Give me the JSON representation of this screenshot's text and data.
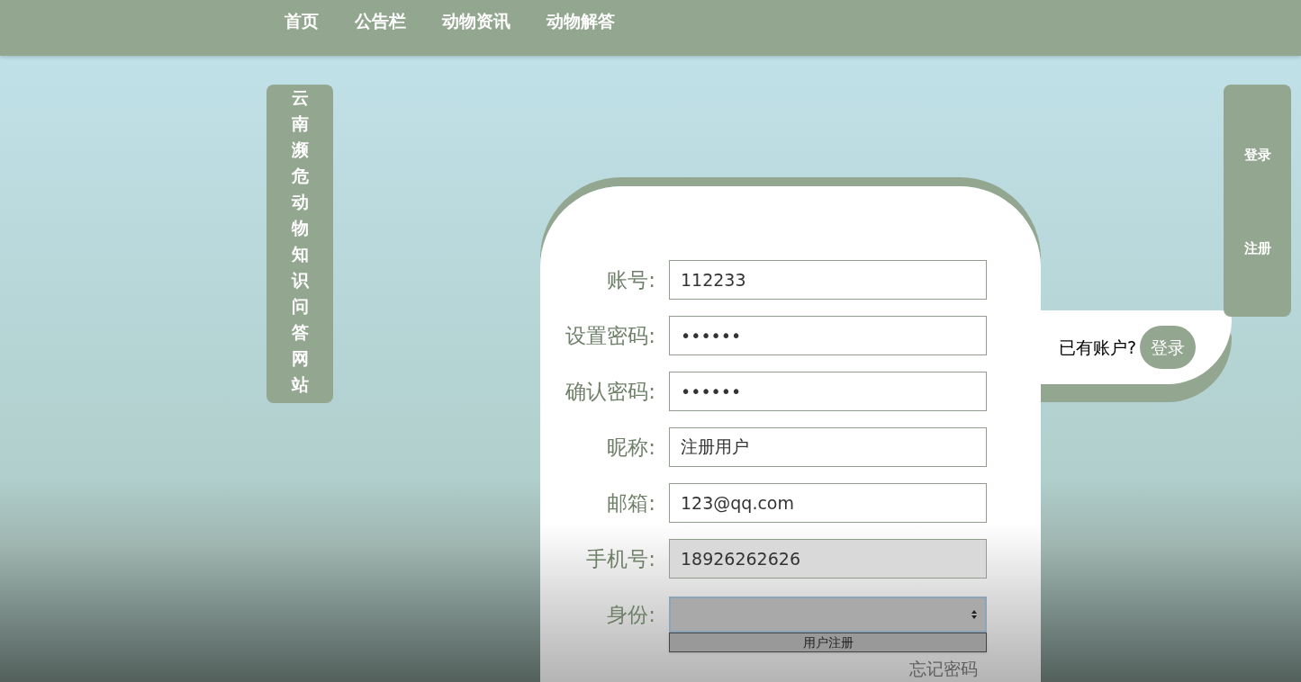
{
  "nav": {
    "items": [
      "首页",
      "公告栏",
      "动物资讯",
      "动物解答"
    ]
  },
  "site_title": "云南濒危动物知识问答网站",
  "form": {
    "fields": [
      {
        "kind": "text",
        "label": "账号:",
        "value": "112233"
      },
      {
        "kind": "text",
        "label": "设置密码:",
        "value": "••••••"
      },
      {
        "kind": "text",
        "label": "确认密码:",
        "value": "••••••"
      },
      {
        "kind": "text",
        "label": "昵称:",
        "value": "注册用户"
      },
      {
        "kind": "text",
        "label": "邮箱:",
        "value": "123@qq.com"
      },
      {
        "kind": "text",
        "label": "手机号:",
        "value": "18926262626"
      },
      {
        "kind": "select",
        "label": "身份:",
        "expanded": true,
        "options": [
          "用户注册"
        ]
      }
    ],
    "forgot_link": "忘记密码"
  },
  "switch_tab": {
    "prompt": "已有账户?",
    "button": "登录"
  },
  "side_menu": [
    "登录",
    "注册"
  ]
}
